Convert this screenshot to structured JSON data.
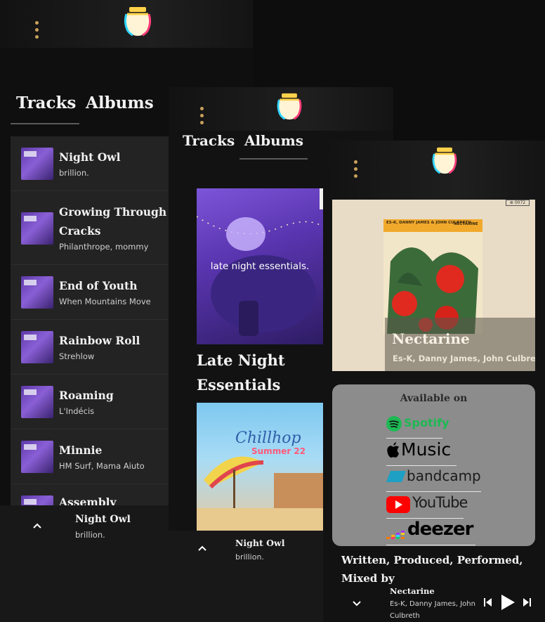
{
  "brand": {
    "logo_icon": "jar-logo-icon",
    "accent": "#c9a15a"
  },
  "tabs": {
    "tracks": "Tracks",
    "albums": "Albums"
  },
  "tracks": [
    {
      "title": "Night Owl",
      "artist": "brillion."
    },
    {
      "title": "Growing Through T",
      "title_line2": "Cracks",
      "artist": "Philanthrope, mommy"
    },
    {
      "title": "End of Youth",
      "artist": "When Mountains Move"
    },
    {
      "title": "Rainbow Roll",
      "artist": "Strehlow"
    },
    {
      "title": "Roaming",
      "artist": "L'Indécis"
    },
    {
      "title": "Minnie",
      "artist": "HM Surf, Mama Aiuto"
    },
    {
      "title": "Assembly",
      "artist": ""
    }
  ],
  "now_playing": {
    "title": "Night Owl",
    "artist": "brillion."
  },
  "albums": [
    {
      "cover_caption": "late night essentials.",
      "title_line1": "Late Night",
      "title_line2": "Essentials"
    },
    {
      "cover_title": "Chillhop",
      "cover_subtitle": "Summer 22"
    }
  ],
  "detail": {
    "album_title": "Nectarine",
    "album_artists": "Es-K, Danny James, John Culbreth",
    "cover_artists_small": "ES-K, DANNY JAMES & JOHN CULBRETH",
    "cover_title_small": "NECTARINE",
    "available_on": "Available on",
    "platforms": [
      {
        "name": "Spotify",
        "icon": "spotify-icon",
        "color": "#1db954"
      },
      {
        "name": "Music",
        "icon": "apple-icon",
        "color": "#000000"
      },
      {
        "name": "bandcamp",
        "icon": "bandcamp-icon",
        "color": "#1b1b1b"
      },
      {
        "name": "YouTube",
        "icon": "youtube-icon",
        "color": "#ff0000"
      },
      {
        "name": "deezer",
        "icon": "deezer-icon",
        "color": "#000000"
      }
    ],
    "credits_line1": "Written, Produced, Performed,",
    "credits_line2": "Mixed by"
  },
  "detail_player": {
    "title": "Nectarine",
    "artist_line1": "Es-K, Danny James, John",
    "artist_line2": "Culbreth"
  }
}
